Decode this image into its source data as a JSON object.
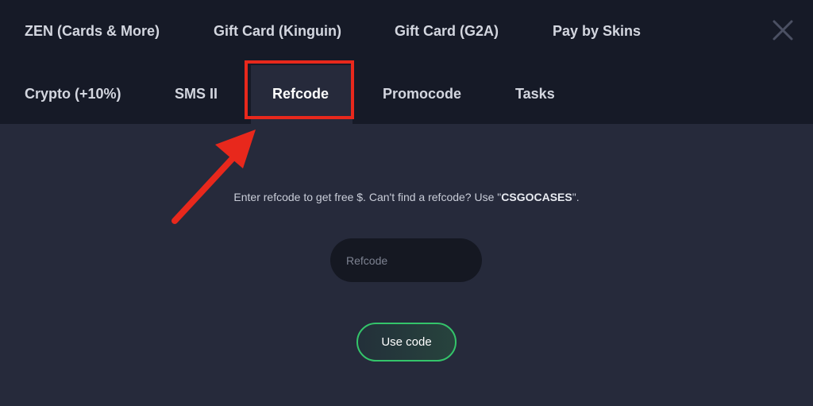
{
  "colors": {
    "highlight": "#e8281c",
    "accent": "#34c46a"
  },
  "tabs_row1": [
    {
      "label": "ZEN (Cards & More)"
    },
    {
      "label": "Gift Card (Kinguin)"
    },
    {
      "label": "Gift Card (G2A)"
    },
    {
      "label": "Pay by Skins"
    }
  ],
  "tabs_row2": [
    {
      "label": "Crypto (+10%)"
    },
    {
      "label": "SMS II"
    },
    {
      "label": "Refcode",
      "active": true
    },
    {
      "label": "Promocode"
    },
    {
      "label": "Tasks"
    }
  ],
  "close": {
    "icon": "close-icon"
  },
  "refcode_panel": {
    "info_prefix": "Enter refcode to get free $. Can't find a refcode? Use \"",
    "code": "CSGOCASES",
    "info_suffix": "\".",
    "input_placeholder": "Refcode",
    "input_value": "",
    "button_label": "Use code"
  }
}
